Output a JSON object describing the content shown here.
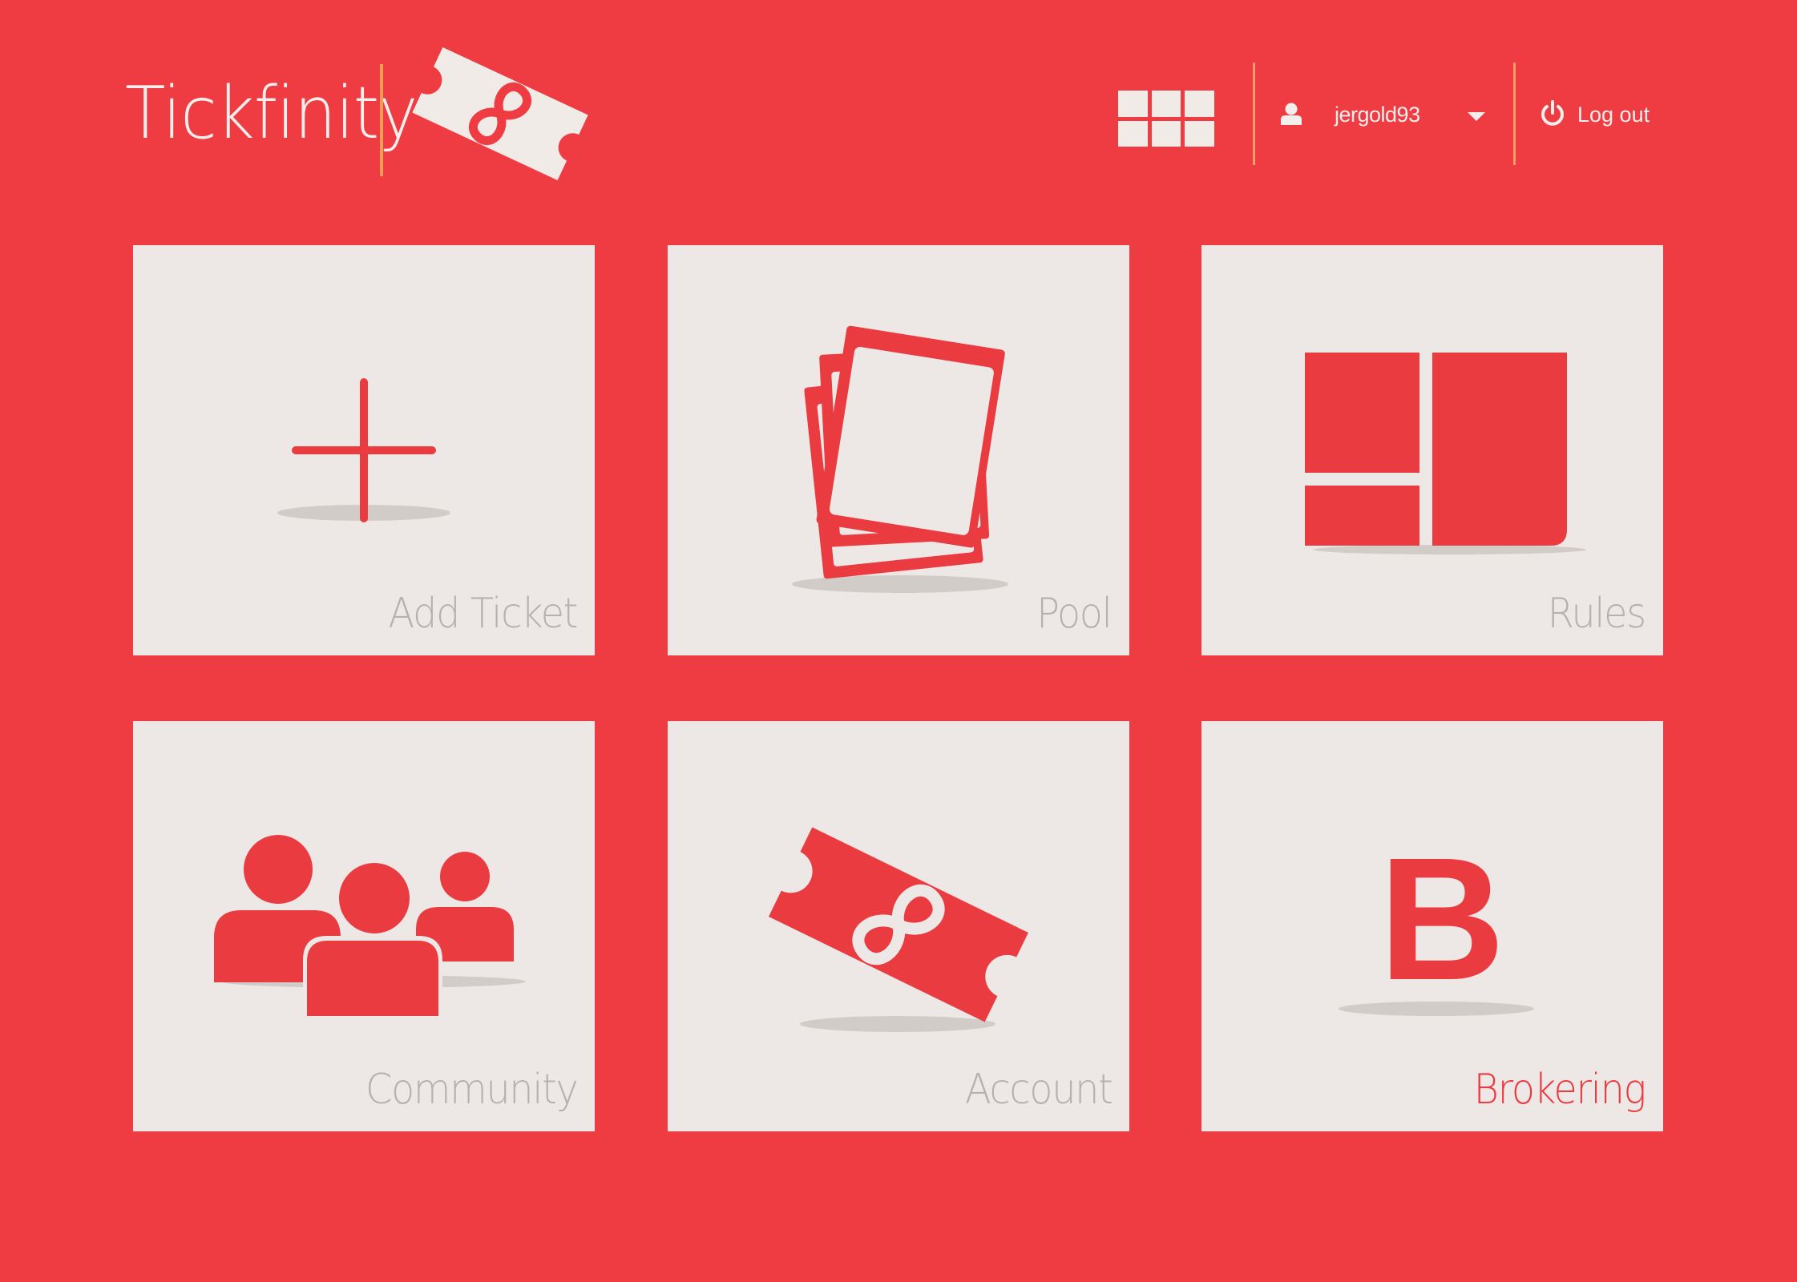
{
  "app": {
    "logo_text": "Tickfinity",
    "brand_color": "#ef3c42",
    "tile_color": "#ede8e5",
    "accent_line_color": "#f4a067"
  },
  "header": {
    "apps_icon": "grid-icon",
    "user": {
      "icon": "user-icon",
      "username": "jergold93",
      "dropdown_icon": "chevron-down-icon"
    },
    "logout": {
      "icon": "power-icon",
      "label": "Log out"
    }
  },
  "tiles": [
    {
      "label": "Add Ticket",
      "icon": "plus-icon",
      "active": false
    },
    {
      "label": "Pool",
      "icon": "stacked-cards-icon",
      "active": false
    },
    {
      "label": "Rules",
      "icon": "layout-blocks-icon",
      "active": false
    },
    {
      "label": "Community",
      "icon": "people-group-icon",
      "active": false
    },
    {
      "label": "Account",
      "icon": "infinity-ticket-icon",
      "active": false
    },
    {
      "label": "Brokering",
      "icon": "letter-b-icon",
      "active": true
    }
  ],
  "tile_icon_letter": "B"
}
